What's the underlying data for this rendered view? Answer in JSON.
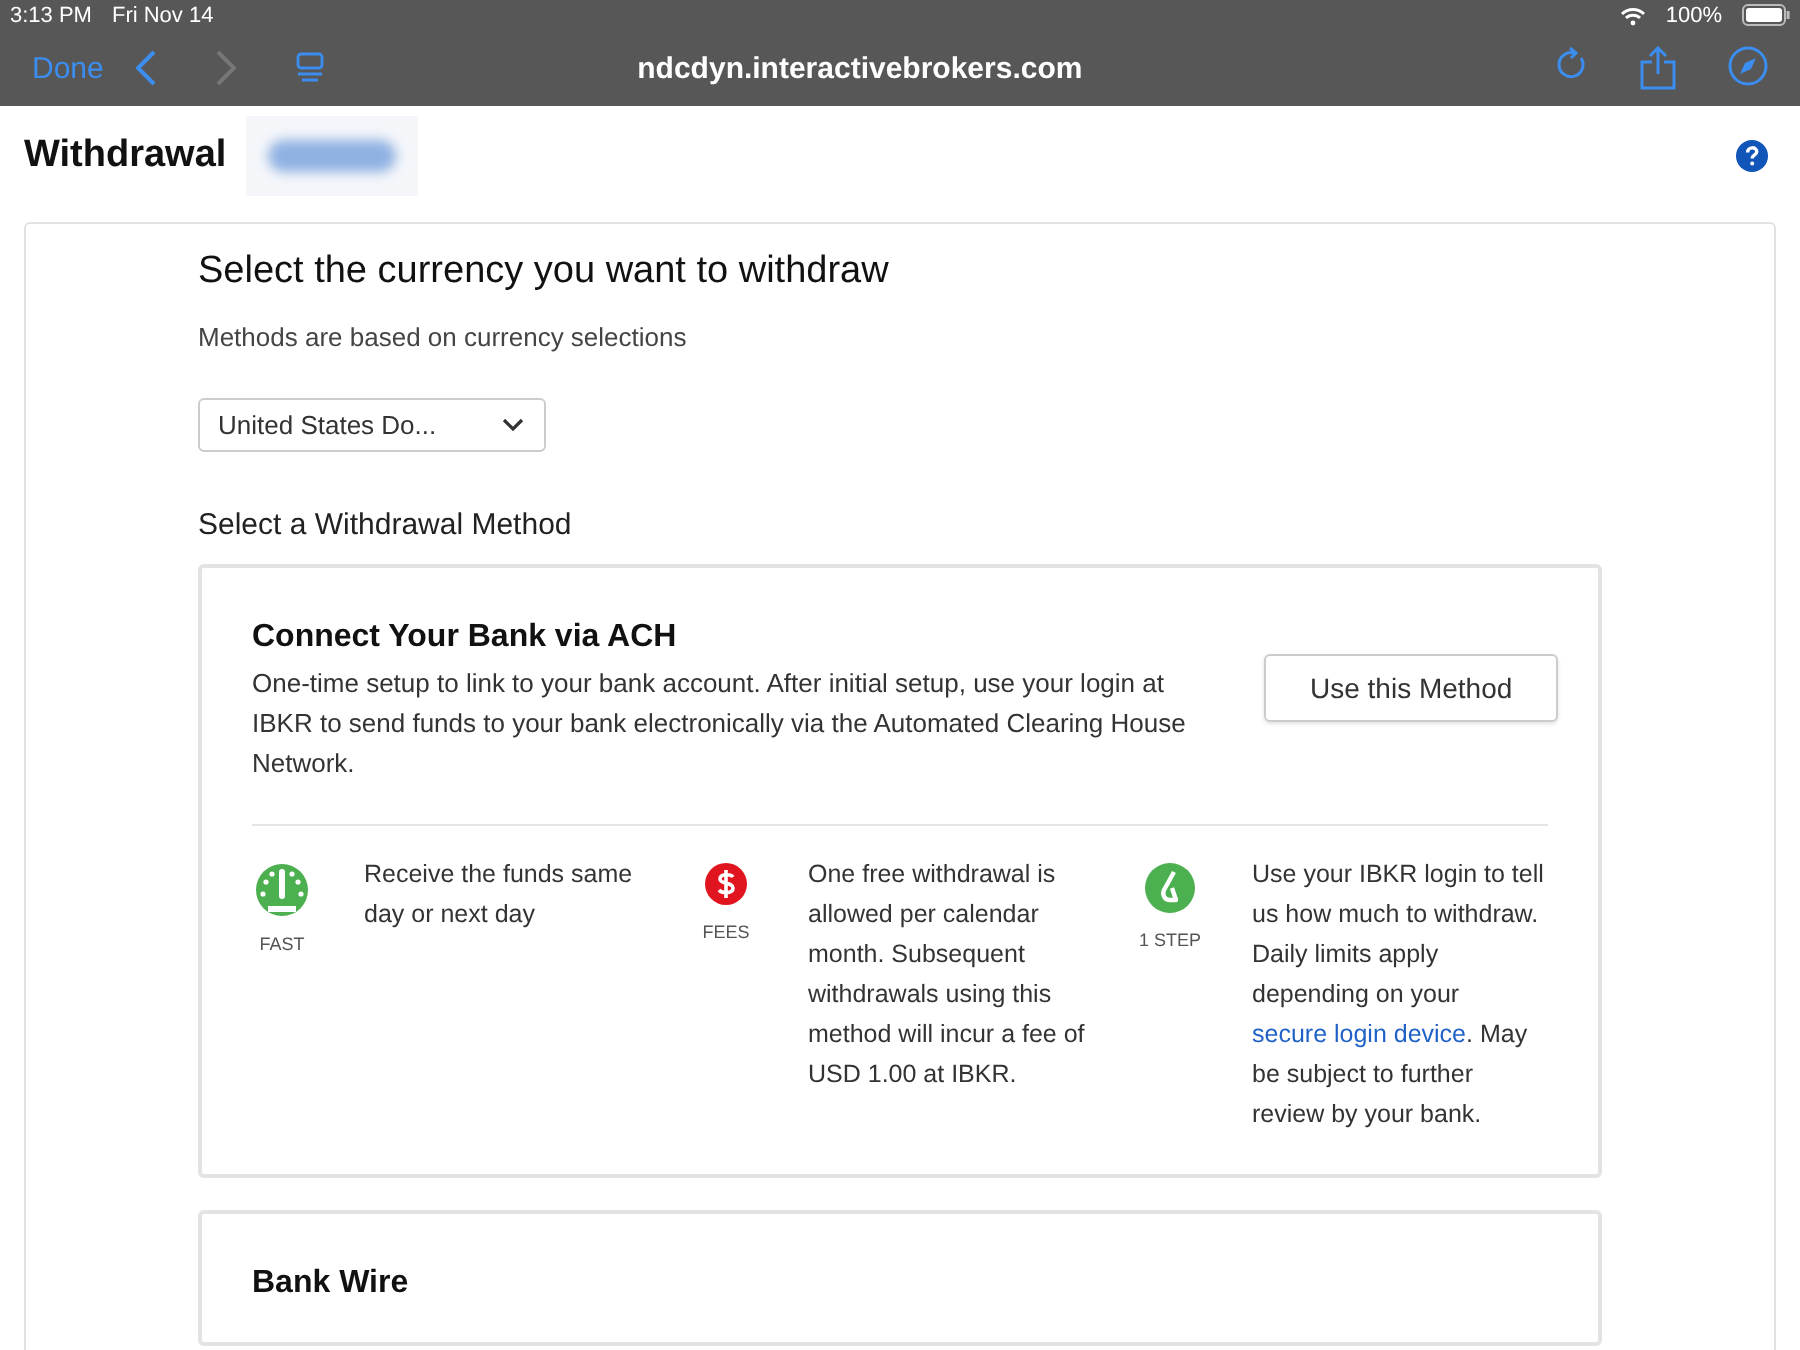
{
  "status_bar": {
    "time": "3:13 PM",
    "date": "Fri Nov 14",
    "battery": "100%"
  },
  "browser": {
    "done": "Done",
    "url": "ndcdyn.interactivebrokers.com",
    "nav": [
      {
        "kind": "back",
        "disabled": false
      },
      {
        "kind": "forward",
        "disabled": true
      }
    ]
  },
  "page": {
    "title": "Withdrawal",
    "heading": "Select the currency you want to withdraw",
    "subheading": "Methods are based on currency selections",
    "currency": "United States Do...",
    "method_heading": "Select a Withdrawal Method"
  },
  "methods": [
    {
      "title": "Connect Your Bank via ACH",
      "description": "One-time setup to link to your bank account. After initial setup, use your login at IBKR to send funds to your bank electronically via the Automated Clearing House Network.",
      "button": "Use this Method",
      "features": [
        {
          "kind": "speed",
          "label": "FAST",
          "text": "Receive the funds same day or next day"
        },
        {
          "kind": "fees",
          "label": "FEES",
          "text": "One free withdrawal is allowed per calendar month. Subsequent withdrawals using this method will incur a fee of USD 1.00 at IBKR."
        },
        {
          "kind": "steps",
          "label": "1 STEP",
          "text": "Use your IBKR login to tell us how much to withdraw. Daily limits apply depending on your",
          "link": "secure login device",
          "text_after": ". May be subject to further review by your bank."
        }
      ]
    },
    {
      "title": "Bank Wire"
    }
  ]
}
